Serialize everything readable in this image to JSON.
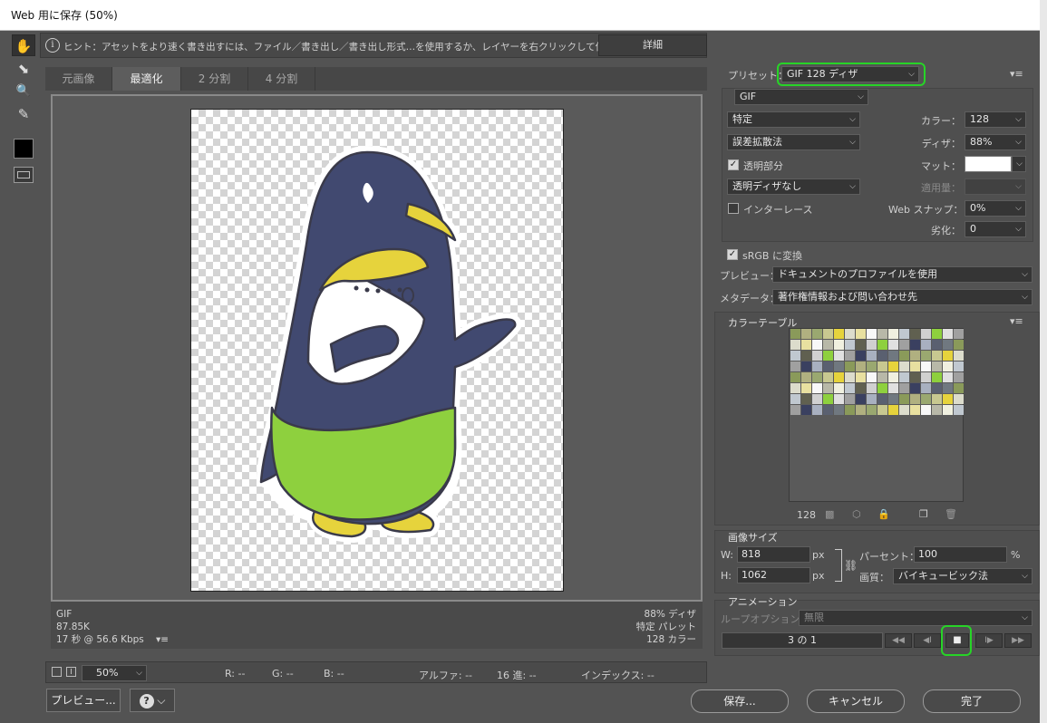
{
  "window": {
    "title": "Web 用に保存 (50%)"
  },
  "hint": {
    "text": "ヒント：アセットをより速く書き出すには、ファイル／書き出し／書き出し形式…を使用するか、レイヤーを右クリックして使用。",
    "detail_button": "詳細",
    "info_icon": "i"
  },
  "tools": [
    {
      "name": "hand-tool",
      "icon": "✋"
    },
    {
      "name": "slice-select-tool",
      "icon": "⬊"
    },
    {
      "name": "zoom-tool",
      "icon": "🔍"
    },
    {
      "name": "eyedropper-tool",
      "icon": "✎"
    }
  ],
  "tabs": [
    "元画像",
    "最適化",
    "2 分割",
    "4 分割"
  ],
  "info": {
    "format": "GIF",
    "size": "87.85K",
    "time": "17 秒 @ 56.6 Kbps",
    "dither": "88% ディザ",
    "palette": "特定 パレット",
    "colors": "128 カラー"
  },
  "status": {
    "zoom": "50%",
    "r": "R: --",
    "g": "G: --",
    "b": "B: --",
    "alpha": "アルファ: --",
    "hex": "16 進: --",
    "index": "インデックス: --"
  },
  "bottom": {
    "preview": "プレビュー...",
    "help": "?",
    "save": "保存...",
    "cancel": "キャンセル",
    "done": "完了"
  },
  "settings": {
    "preset_label": "プリセット：",
    "preset": "GIF 128 ディザ",
    "format": "GIF",
    "reduction": "特定",
    "dither_algo": "誤差拡散法",
    "transparency": "透明部分",
    "transparency_dither": "透明ディザなし",
    "interlace": "インターレース",
    "colors_label": "カラー：",
    "colors": "128",
    "dither_label": "ディザ：",
    "dither": "88%",
    "matte_label": "マット：",
    "amount_label": "適用量：",
    "websnap_label": "Web スナップ：",
    "websnap": "0%",
    "lossy_label": "劣化：",
    "lossy": "0",
    "srgb": "sRGB に変換",
    "preview_label": "プレビュー：",
    "preview": "ドキュメントのプロファイルを使用",
    "metadata_label": "メタデータ：",
    "metadata": "著作権情報および問い合わせ先"
  },
  "color_table": {
    "title": "カラーテーブル",
    "count": "128"
  },
  "image_size": {
    "title": "画像サイズ",
    "w_label": "W:",
    "w": "818",
    "h_label": "H:",
    "h": "1062",
    "px": "px",
    "percent_label": "パーセント：",
    "percent": "100",
    "percent_unit": "%",
    "quality_label": "画質：",
    "quality": "バイキュービック法"
  },
  "animation": {
    "title": "アニメーション",
    "loop_label": "ループオプション：",
    "loop": "無限",
    "frame": "3 の 1"
  }
}
